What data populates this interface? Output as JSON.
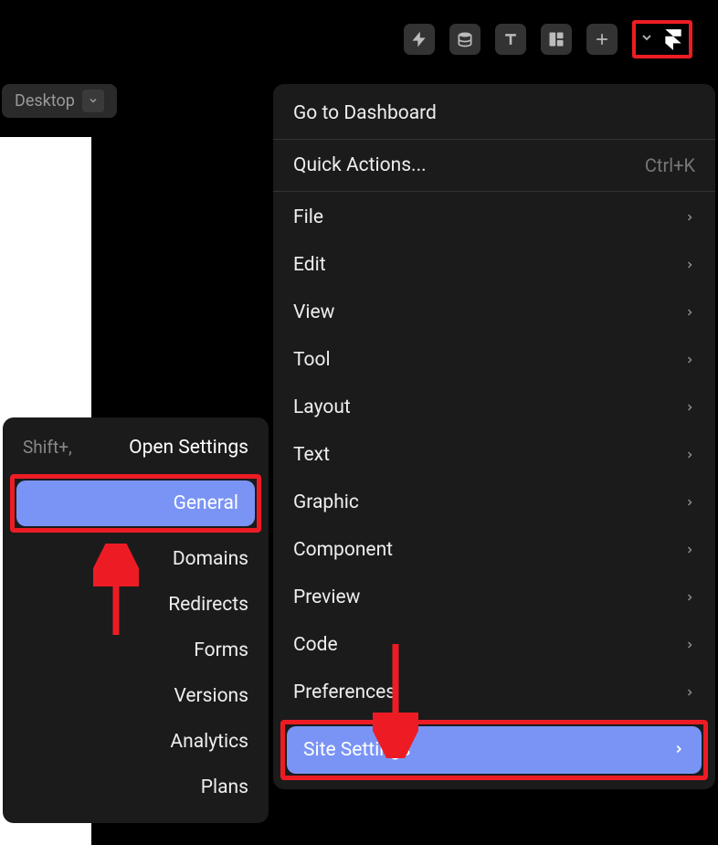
{
  "toolbar": {
    "icons": [
      "bolt",
      "database",
      "text",
      "layout",
      "plus"
    ]
  },
  "device": {
    "label": "Desktop"
  },
  "menu": {
    "dashboard": "Go to Dashboard",
    "quickActions": "Quick Actions...",
    "quickActionsShortcut": "Ctrl+K",
    "items": [
      "File",
      "Edit",
      "View",
      "Tool",
      "Layout",
      "Text",
      "Graphic",
      "Component",
      "Preview",
      "Code",
      "Preferences"
    ],
    "siteSettings": "Site Settings"
  },
  "subMenu": {
    "header": "Open Settings",
    "headerShortcut": "Shift+,",
    "general": "General",
    "items": [
      "Domains",
      "Redirects",
      "Forms",
      "Versions",
      "Analytics",
      "Plans"
    ]
  },
  "colors": {
    "accent": "#7a94f5",
    "highlight": "#ed1c24"
  }
}
